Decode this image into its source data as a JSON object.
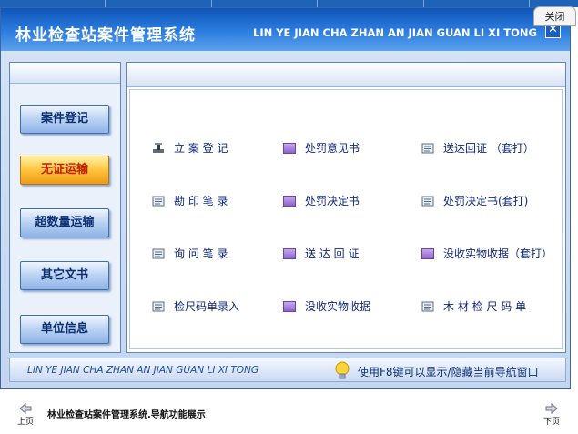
{
  "window": {
    "title_cn": "林业检查站案件管理系统",
    "title_en": "LIN YE JIAN CHA ZHAN AN JIAN GUAN LI XI TONG",
    "close_tab_label": "关闭",
    "close_x": "✕"
  },
  "sidebar": {
    "items": [
      {
        "label": "案件登记",
        "active": false
      },
      {
        "label": "无证运输",
        "active": true
      },
      {
        "label": "超数量运输",
        "active": false
      },
      {
        "label": "其它文书",
        "active": false
      },
      {
        "label": "单位信息",
        "active": false
      }
    ]
  },
  "main": {
    "items": [
      {
        "label": "立 案 登 记",
        "icon": "stamp-icon"
      },
      {
        "label": "处罚意见书",
        "icon": "purple-square-icon"
      },
      {
        "label": "送达回证 （套打）",
        "icon": "document-icon"
      },
      {
        "label": "勘 印 笔 录",
        "icon": "document-icon"
      },
      {
        "label": "处罚决定书",
        "icon": "purple-square-icon"
      },
      {
        "label": "处罚决定书(套打)",
        "icon": "document-icon"
      },
      {
        "label": "询 问 笔 录",
        "icon": "document-icon"
      },
      {
        "label": "送 达 回 证",
        "icon": "purple-square-icon"
      },
      {
        "label": "没收实物收据（套打）",
        "icon": "purple-square-icon"
      },
      {
        "label": "检尺码单录入",
        "icon": "document-icon"
      },
      {
        "label": "没收实物收据",
        "icon": "purple-square-icon"
      },
      {
        "label": "木 材 检 尺 码 单",
        "icon": "document-icon"
      }
    ]
  },
  "footer": {
    "left_text": "LIN YE JIAN CHA ZHAN AN JIAN GUAN LI XI TONG",
    "hint": "使用F8键可以显示/隐藏当前导航窗口"
  },
  "page": {
    "caption": "林业检查站案件管理系统.导航功能展示",
    "prev_label": "上页",
    "next_label": "下页"
  }
}
